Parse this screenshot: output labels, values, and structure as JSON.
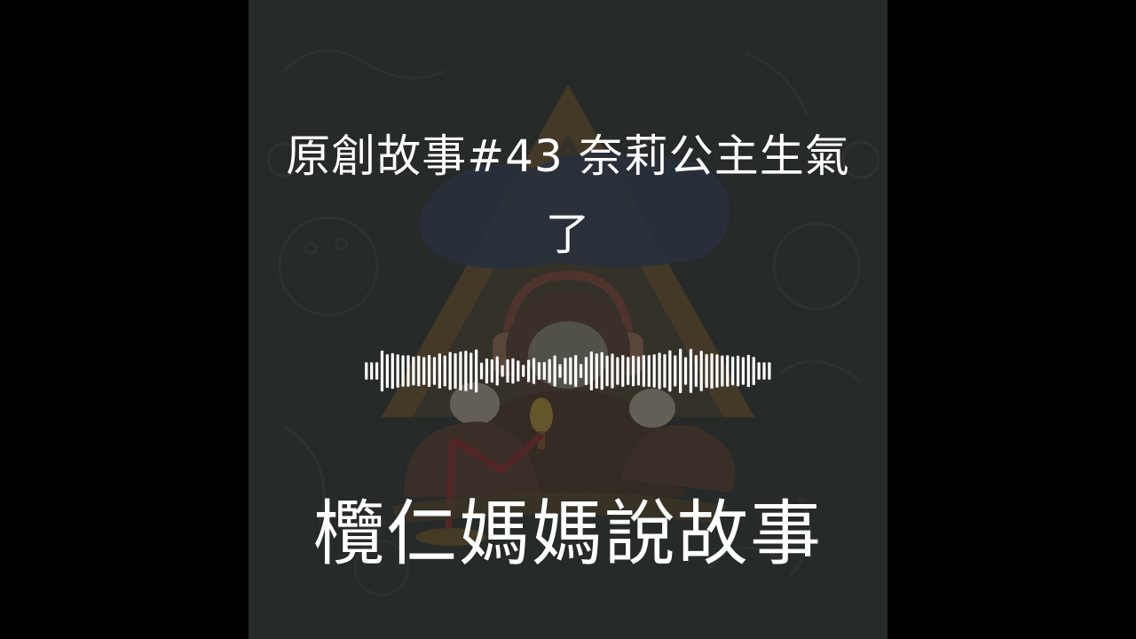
{
  "episode": {
    "title": "原創故事#43 奈莉公主生氣了"
  },
  "podcast": {
    "name": "欖仁媽媽說故事"
  },
  "waveform": {
    "bar_count": 78
  },
  "colors": {
    "background": "#000000",
    "cover_tint": "#2c302e",
    "text": "#ffffff",
    "waveform": "#ffffff",
    "art_roof": "#8a6a3c",
    "art_sloth": "#4a3a30",
    "art_face": "#c9c3b6",
    "art_mic": "#a88a3a",
    "art_stand": "#8a2e2e"
  },
  "icons": {
    "cover_art": "sloth-podcast-illustration"
  }
}
